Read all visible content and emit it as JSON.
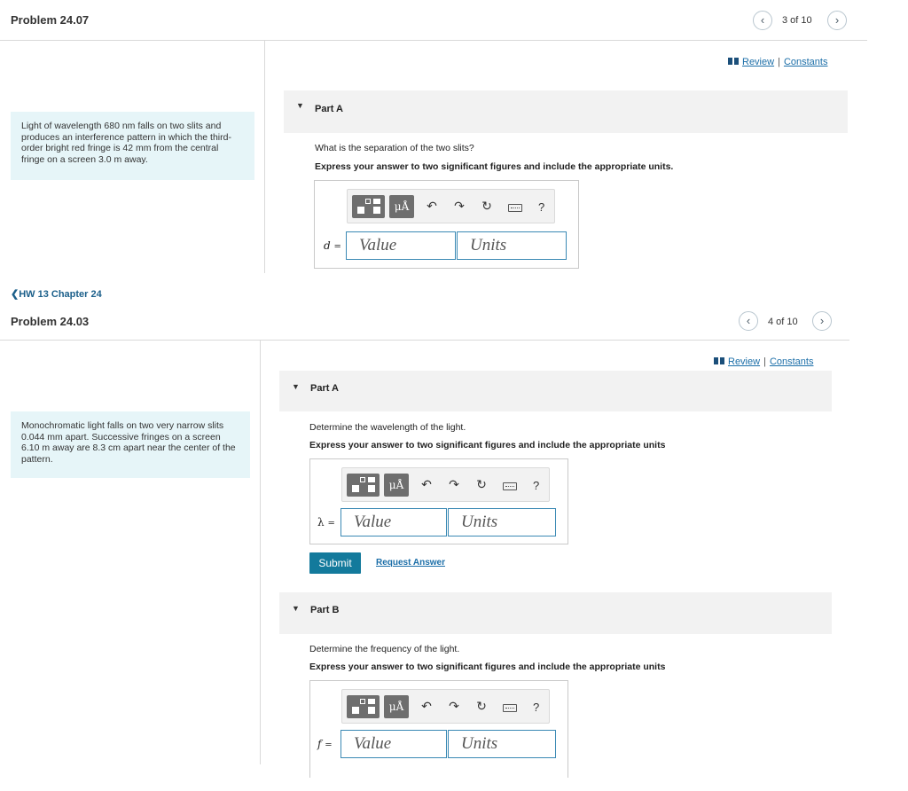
{
  "top": {
    "title": "Problem 24.07",
    "nav": {
      "prev": "‹",
      "position": "3 of 10",
      "next": "›"
    },
    "links": {
      "review": "Review",
      "separator": "|",
      "constants": "Constants"
    },
    "problem_text": "Light of wavelength 680 nm falls on two slits and produces an interference pattern in which the third-order bright red fringe is 42 mm from the central fringe on a screen 3.0 m away.",
    "partA": {
      "label": "Part A",
      "question": "What is the separation of the two slits?",
      "instruction": "Express your answer to two significant figures and include the appropriate units.",
      "var": "d",
      "eq": "=",
      "value_placeholder": "Value",
      "units_placeholder": "Units"
    }
  },
  "back_link": "❮HW 13 Chapter 24",
  "bottom": {
    "title": "Problem 24.03",
    "nav": {
      "prev": "‹",
      "position": "4 of 10",
      "next": "›"
    },
    "links": {
      "review": "Review",
      "separator": "|",
      "constants": "Constants"
    },
    "problem_text": "Monochromatic light falls on two very narrow slits 0.044 mm apart. Successive fringes on a screen 6.10 m away are 8.3 cm apart near the center of the pattern.",
    "partA": {
      "label": "Part A",
      "question": "Determine the wavelength of the light.",
      "instruction": "Express your answer to two significant figures and include the appropriate units",
      "var": "λ",
      "eq": "=",
      "value_placeholder": "Value",
      "units_placeholder": "Units",
      "submit": "Submit",
      "request": "Request Answer"
    },
    "partB": {
      "label": "Part B",
      "question": "Determine the frequency of the light.",
      "instruction": "Express your answer to two significant figures and include the appropriate units",
      "var": "f",
      "eq": "=",
      "value_placeholder": "Value",
      "units_placeholder": "Units"
    }
  },
  "toolbar": {
    "mu": "μÅ",
    "undo": "↶",
    "redo": "↷",
    "reset": "↻",
    "help": "?"
  },
  "icons": {
    "templates": "templates-icon",
    "units": "units-icon",
    "undo": "undo-icon",
    "redo": "redo-icon",
    "reset": "reset-icon",
    "keyboard": "keyboard-icon",
    "help": "help-icon",
    "book": "book-icon"
  },
  "colors": {
    "accent": "#137a9c",
    "link": "#1b6ea8",
    "problem_bg": "#e6f5f8",
    "part_bg": "#f2f2f2",
    "field_border": "#3a89b4"
  }
}
